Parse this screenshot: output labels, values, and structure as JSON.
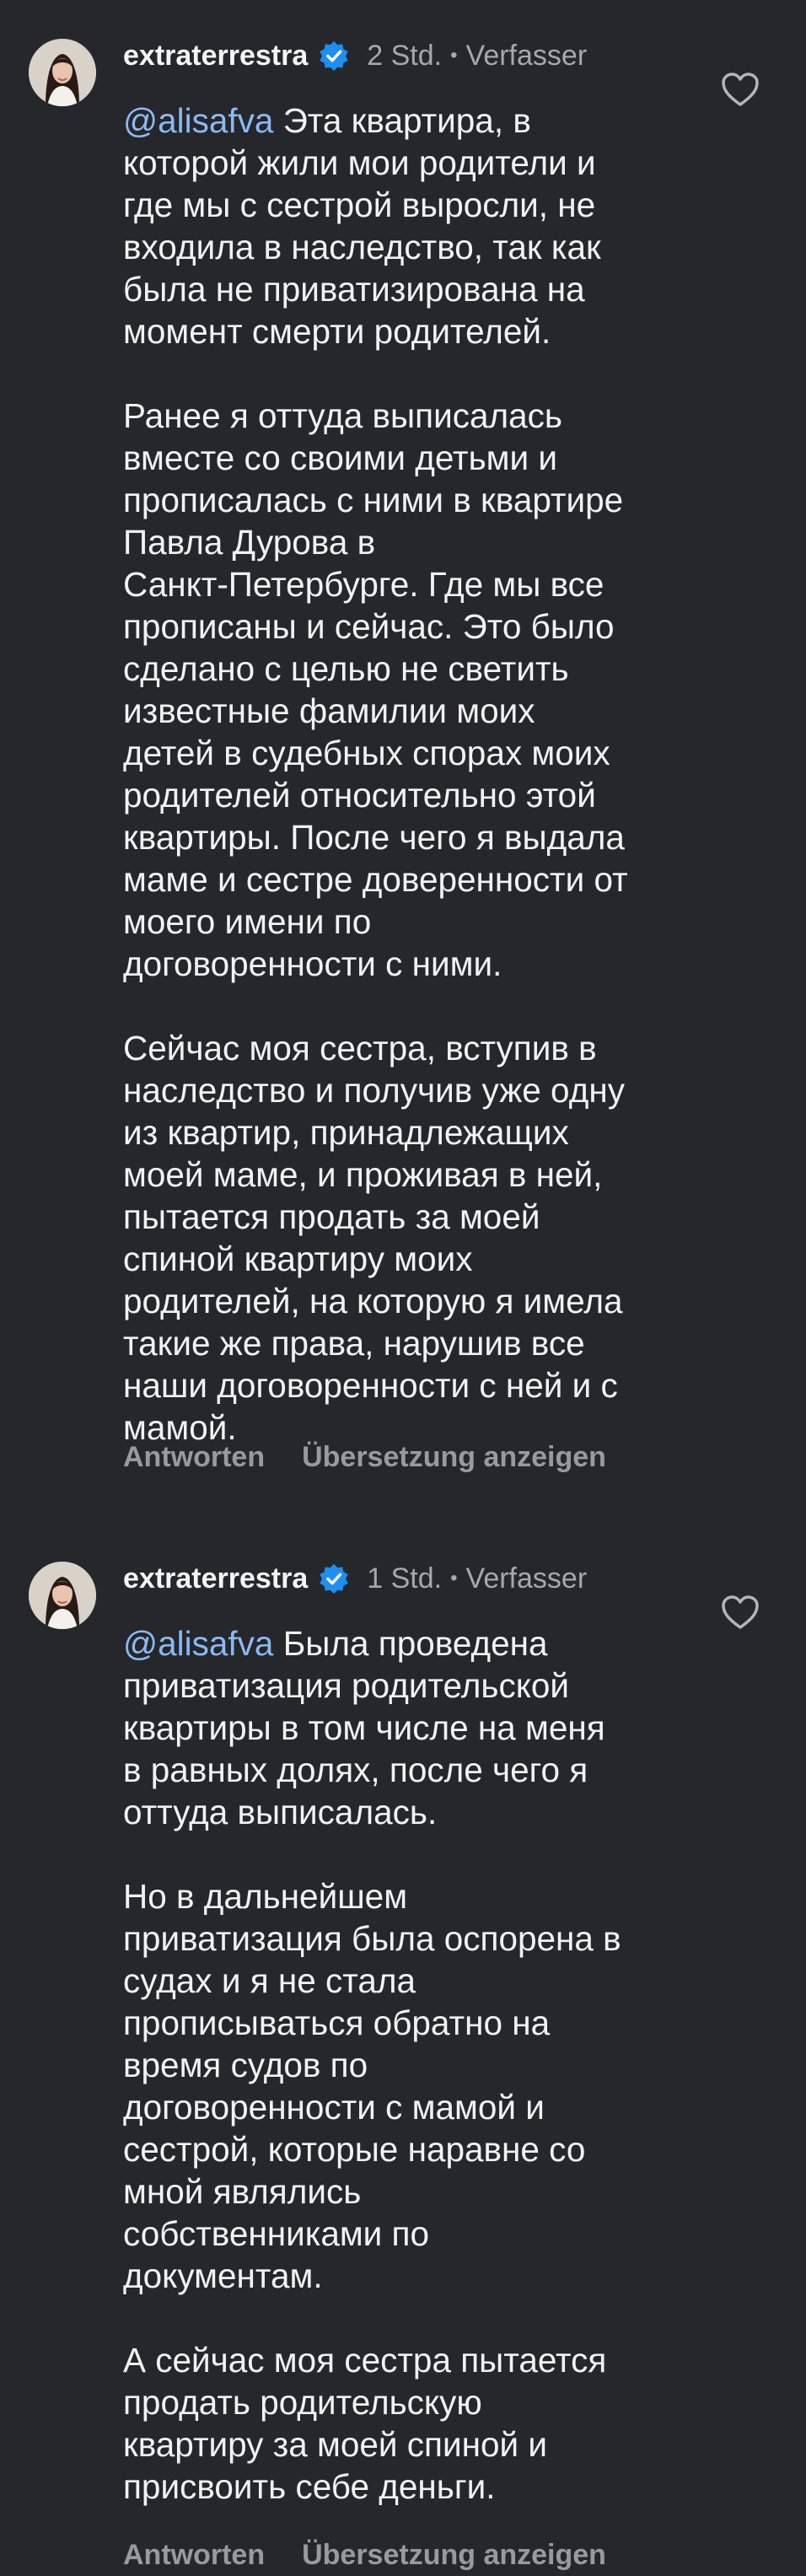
{
  "colors": {
    "background": "#25272b",
    "text": "#f2f2f2",
    "muted": "#a8a8a8",
    "mention": "#8cb9f2",
    "verified": "#1d8ff0"
  },
  "comments": [
    {
      "username": "extraterrestra",
      "verified_icon": "verified-badge-icon",
      "time": "2 Std.",
      "separator": "•",
      "author_label": "Verfasser",
      "mention": "@alisafva",
      "lines": [
        " Эта квартира, в",
        "которой жили мои родители и",
        "где мы с сестрой выросли, не",
        "входила в наследство, так как",
        "была не приватизирована на",
        "момент смерти родителей."
      ],
      "paragraphs": [
        [
          "Ранее я оттуда выписалась",
          "вместе со своими детьми и",
          "прописалась с ними в квартире",
          "Павла Дурова в",
          "Санкт-Петербурге. Где мы все",
          "прописаны и сейчас. Это было",
          "сделано с целью не светить",
          "известные фамилии моих",
          "детей в судебных спорах моих",
          "родителей относительно этой",
          "квартиры. После чего я выдала",
          "маме и сестре доверенности от",
          "моего имени по",
          "договоренности с ними."
        ],
        [
          "Сейчас моя сестра, вступив в",
          "наследство и получив уже одну",
          "из квартир, принадлежащих",
          "моей маме, и проживая в ней,",
          "пытается продать за моей",
          "спиной квартиру моих",
          "родителей, на которую я имела",
          "такие же права, нарушив все",
          "наши договоренности с ней и с",
          "мамой."
        ]
      ],
      "reply_label": "Antworten",
      "translate_label": "Übersetzung anzeigen"
    },
    {
      "username": "extraterrestra",
      "verified_icon": "verified-badge-icon",
      "time": "1 Std.",
      "separator": "•",
      "author_label": "Verfasser",
      "mention": "@alisafva",
      "lines": [
        " Была проведена",
        "приватизация родительской",
        "квартиры в том числе на меня",
        "в равных долях, после чего я",
        "оттуда выписалась."
      ],
      "paragraphs": [
        [
          "Но в дальнейшем",
          "приватизация была оспорена в",
          "судах и я не стала",
          "прописываться обратно на",
          "время судов по",
          "договоренности с мамой и",
          "сестрой, которые наравне со",
          "мной являлись",
          "собственниками по",
          "документам."
        ],
        [
          "А сейчас моя сестра пытается",
          "продать родительскую",
          "квартиру за моей спиной и",
          "присвоить себе деньги."
        ]
      ],
      "reply_label": "Antworten",
      "translate_label": "Übersetzung anzeigen"
    }
  ]
}
